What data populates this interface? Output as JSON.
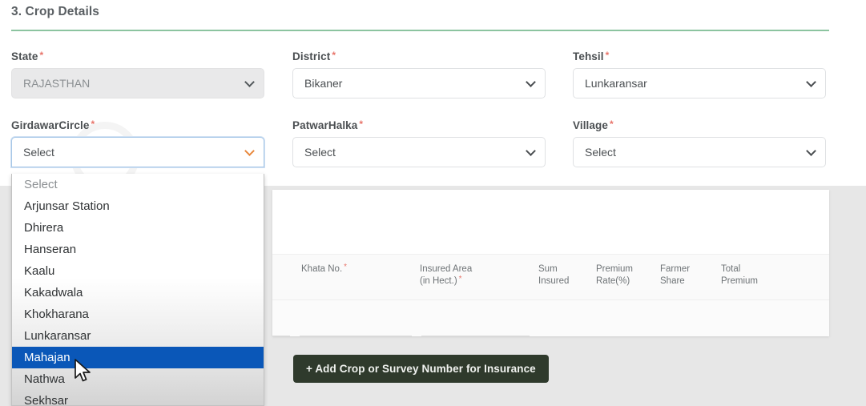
{
  "section": {
    "heading": "3. Crop Details",
    "required_marker": "*"
  },
  "form": {
    "state": {
      "label": "State",
      "value": "RAJASTHAN",
      "disabled": true
    },
    "district": {
      "label": "District",
      "value": "Bikaner"
    },
    "tehsil": {
      "label": "Tehsil",
      "value": "Lunkaransar"
    },
    "girdawar_circle": {
      "label": "GirdawarCircle",
      "value": "Select",
      "open": true,
      "options": [
        "Select",
        "Arjunsar Station",
        "Dhirera",
        "Hanseran",
        "Kaalu",
        "Kakadwala",
        "Khokharana",
        "Lunkaransar",
        "Mahajan",
        "Nathwa",
        "Sekhsar"
      ],
      "highlighted_option": "Mahajan"
    },
    "patwar_halka": {
      "label": "PatwarHalka",
      "value": "Select"
    },
    "village": {
      "label": "Village",
      "value": "Select"
    }
  },
  "crop_table": {
    "columns": {
      "khata_no": "Khata No.",
      "insured_area_line1": "Insured Area",
      "insured_area_line2": "(in Hect.)",
      "sum_insured_line1": "Sum",
      "sum_insured_line2": "Insured",
      "premium_rate_line1": "Premium",
      "premium_rate_line2": "Rate(%)",
      "farmer_share_line1": "Farmer",
      "farmer_share_line2": "Share",
      "total_premium_line1": "Total",
      "total_premium_line2": "Premium"
    }
  },
  "actions": {
    "add_crop_label": "+ Add Crop or Survey Number for Insurance"
  },
  "colors": {
    "divider_green": "#8cc4a0",
    "highlight_blue": "#0a57b8",
    "button_dark_green": "#2f3a2c",
    "required_red": "#e8746a",
    "focus_chevron_orange": "#e8883c"
  }
}
